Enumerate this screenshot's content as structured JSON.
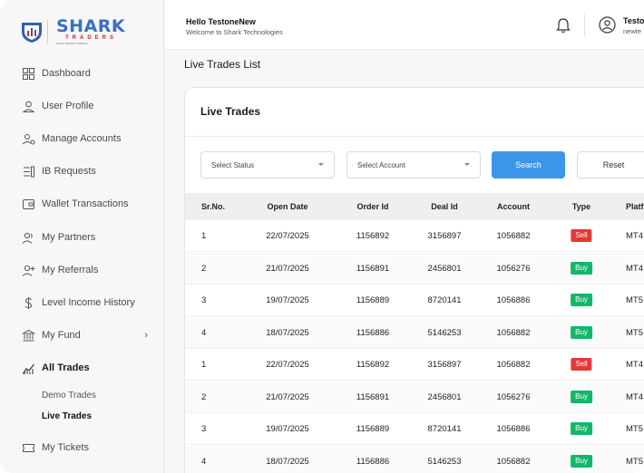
{
  "brand": {
    "name": "SHARK",
    "sub": "TRADERS",
    "tagline": "MAKE TRADING SIMPLE"
  },
  "sidebar": {
    "items": [
      {
        "label": "Dashboard",
        "icon": "dashboard-icon"
      },
      {
        "label": "User Profile",
        "icon": "user-icon"
      },
      {
        "label": "Manage Accounts",
        "icon": "manage-accounts-icon"
      },
      {
        "label": "IB Requests",
        "icon": "ib-requests-icon"
      },
      {
        "label": "Wallet Transactions",
        "icon": "wallet-icon"
      },
      {
        "label": "My Partners",
        "icon": "partners-icon"
      },
      {
        "label": "My Referrals",
        "icon": "add-user-icon"
      },
      {
        "label": "Level Income History",
        "icon": "dollar-icon"
      },
      {
        "label": "My Fund",
        "icon": "bank-icon"
      },
      {
        "label": "All Trades",
        "icon": "chart-icon"
      },
      {
        "label": "My Tickets",
        "icon": "ticket-icon"
      }
    ],
    "sub_items": [
      {
        "label": "Demo Trades"
      },
      {
        "label": "Live Trades"
      }
    ],
    "chevron": "›"
  },
  "header": {
    "greeting": "Hello TestoneNew",
    "subtitle": "Welcome to Shark Technologies",
    "user_name": "Testo",
    "user_email": "newte"
  },
  "page": {
    "title": "Live Trades List"
  },
  "card": {
    "title": "Live Trades",
    "status_placeholder": "Select Status",
    "account_placeholder": "Select Account",
    "search_label": "Search",
    "reset_label": "Reset"
  },
  "table": {
    "columns": [
      "Sr.No.",
      "Open Date",
      "Order Id",
      "Deal Id",
      "Account",
      "Type",
      "Platf"
    ],
    "rows": [
      {
        "sr": "1",
        "date": "22/07/2025",
        "order": "1156892",
        "deal": "3156897",
        "account": "1056882",
        "type": "Sell",
        "platform": "MT4"
      },
      {
        "sr": "2",
        "date": "21/07/2025",
        "order": "1156891",
        "deal": "2456801",
        "account": "1056276",
        "type": "Buy",
        "platform": "MT4"
      },
      {
        "sr": "3",
        "date": "19/07/2025",
        "order": "1156889",
        "deal": "8720141",
        "account": "1056886",
        "type": "Buy",
        "platform": "MT5"
      },
      {
        "sr": "4",
        "date": "18/07/2025",
        "order": "1156886",
        "deal": "5146253",
        "account": "1056882",
        "type": "Buy",
        "platform": "MT5"
      },
      {
        "sr": "1",
        "date": "22/07/2025",
        "order": "1156892",
        "deal": "3156897",
        "account": "1056882",
        "type": "Sell",
        "platform": "MT4"
      },
      {
        "sr": "2",
        "date": "21/07/2025",
        "order": "1156891",
        "deal": "2456801",
        "account": "1056276",
        "type": "Buy",
        "platform": "MT4"
      },
      {
        "sr": "3",
        "date": "19/07/2025",
        "order": "1156889",
        "deal": "8720141",
        "account": "1056886",
        "type": "Buy",
        "platform": "MT5"
      },
      {
        "sr": "4",
        "date": "18/07/2025",
        "order": "1156886",
        "deal": "5146253",
        "account": "1056882",
        "type": "Buy",
        "platform": "MT5"
      }
    ]
  },
  "colors": {
    "accent": "#3b95e8",
    "sell": "#e53935",
    "buy": "#12b76a"
  }
}
